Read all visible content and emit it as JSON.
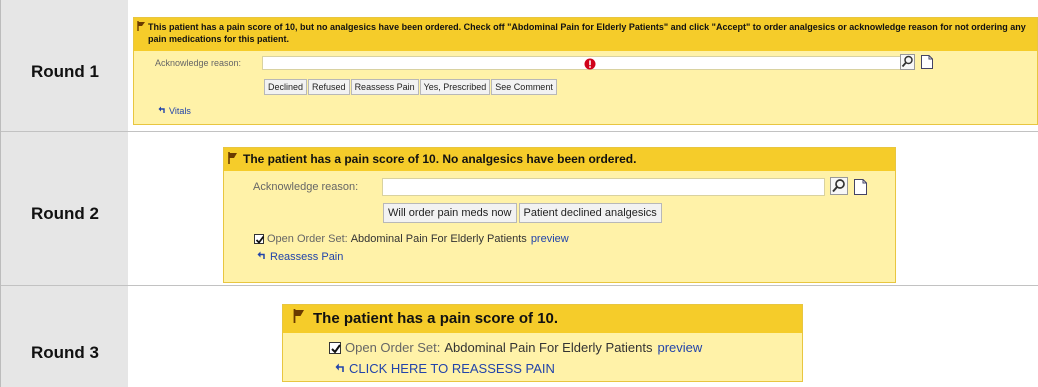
{
  "rounds": [
    {
      "label": "Round 1",
      "alert_text": "This patient has a pain score of 10, but no analgesics have been ordered. Check off \"Abdominal Pain for Elderly Patients\" and click \"Accept\" to order analgesics or acknowledge reason for not ordering any pain medications for this patient.",
      "ack_label": "Acknowledge reason:",
      "buttons": [
        "Declined",
        "Refused",
        "Reassess Pain",
        "Yes, Prescribed",
        "See Comment"
      ],
      "link": "Vitals"
    },
    {
      "label": "Round 2",
      "alert_text": "The patient has a pain score of 10. No analgesics have been ordered.",
      "ack_label": "Acknowledge reason:",
      "buttons": [
        "Will order pain meds now",
        "Patient declined analgesics"
      ],
      "order_set_prefix": "Open Order Set:",
      "order_set_name": "Abdominal Pain For Elderly Patients",
      "preview": "preview",
      "link": "Reassess Pain"
    },
    {
      "label": "Round 3",
      "alert_text": "The patient has a pain score of 10.",
      "order_set_prefix": "Open Order Set:",
      "order_set_name": "Abdominal Pain For Elderly Patients",
      "preview": "preview",
      "link": "CLICK HERE TO REASSESS PAIN"
    }
  ],
  "icons": {
    "flag": "flag-icon",
    "search": "magnifier-icon",
    "note": "document-icon",
    "error": "error-icon",
    "link": "link-arrow-icon",
    "checkbox": "checkbox-icon"
  },
  "colors": {
    "alert_header": "#f5cc2a",
    "alert_body": "#fff2a8",
    "link": "#2244aa",
    "error": "#d0021b"
  }
}
